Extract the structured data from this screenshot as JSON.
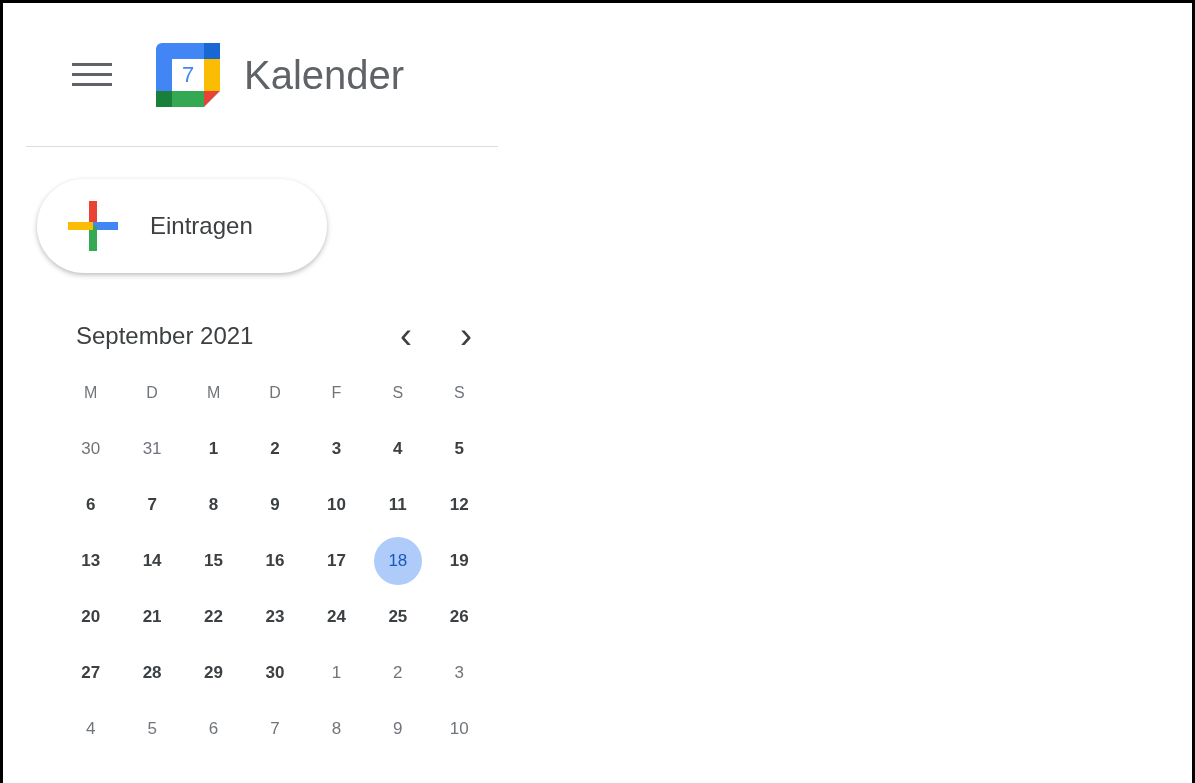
{
  "header": {
    "logo_day": "7",
    "title": "Kalender"
  },
  "create_button": {
    "label": "Eintragen"
  },
  "mini_calendar": {
    "title": "September 2021",
    "prev": "‹",
    "next": "›",
    "weekdays": [
      "M",
      "D",
      "M",
      "D",
      "F",
      "S",
      "S"
    ],
    "weeks": [
      [
        {
          "label": "30",
          "in_month": false,
          "selected": false
        },
        {
          "label": "31",
          "in_month": false,
          "selected": false
        },
        {
          "label": "1",
          "in_month": true,
          "selected": false
        },
        {
          "label": "2",
          "in_month": true,
          "selected": false
        },
        {
          "label": "3",
          "in_month": true,
          "selected": false
        },
        {
          "label": "4",
          "in_month": true,
          "selected": false
        },
        {
          "label": "5",
          "in_month": true,
          "selected": false
        }
      ],
      [
        {
          "label": "6",
          "in_month": true,
          "selected": false
        },
        {
          "label": "7",
          "in_month": true,
          "selected": false
        },
        {
          "label": "8",
          "in_month": true,
          "selected": false
        },
        {
          "label": "9",
          "in_month": true,
          "selected": false
        },
        {
          "label": "10",
          "in_month": true,
          "selected": false
        },
        {
          "label": "11",
          "in_month": true,
          "selected": false
        },
        {
          "label": "12",
          "in_month": true,
          "selected": false
        }
      ],
      [
        {
          "label": "13",
          "in_month": true,
          "selected": false
        },
        {
          "label": "14",
          "in_month": true,
          "selected": false
        },
        {
          "label": "15",
          "in_month": true,
          "selected": false
        },
        {
          "label": "16",
          "in_month": true,
          "selected": false
        },
        {
          "label": "17",
          "in_month": true,
          "selected": false
        },
        {
          "label": "18",
          "in_month": true,
          "selected": true
        },
        {
          "label": "19",
          "in_month": true,
          "selected": false
        }
      ],
      [
        {
          "label": "20",
          "in_month": true,
          "selected": false
        },
        {
          "label": "21",
          "in_month": true,
          "selected": false
        },
        {
          "label": "22",
          "in_month": true,
          "selected": false
        },
        {
          "label": "23",
          "in_month": true,
          "selected": false
        },
        {
          "label": "24",
          "in_month": true,
          "selected": false
        },
        {
          "label": "25",
          "in_month": true,
          "selected": false
        },
        {
          "label": "26",
          "in_month": true,
          "selected": false
        }
      ],
      [
        {
          "label": "27",
          "in_month": true,
          "selected": false
        },
        {
          "label": "28",
          "in_month": true,
          "selected": false
        },
        {
          "label": "29",
          "in_month": true,
          "selected": false
        },
        {
          "label": "30",
          "in_month": true,
          "selected": false
        },
        {
          "label": "1",
          "in_month": false,
          "selected": false
        },
        {
          "label": "2",
          "in_month": false,
          "selected": false
        },
        {
          "label": "3",
          "in_month": false,
          "selected": false
        }
      ],
      [
        {
          "label": "4",
          "in_month": false,
          "selected": false
        },
        {
          "label": "5",
          "in_month": false,
          "selected": false
        },
        {
          "label": "6",
          "in_month": false,
          "selected": false
        },
        {
          "label": "7",
          "in_month": false,
          "selected": false
        },
        {
          "label": "8",
          "in_month": false,
          "selected": false
        },
        {
          "label": "9",
          "in_month": false,
          "selected": false
        },
        {
          "label": "10",
          "in_month": false,
          "selected": false
        }
      ]
    ]
  }
}
